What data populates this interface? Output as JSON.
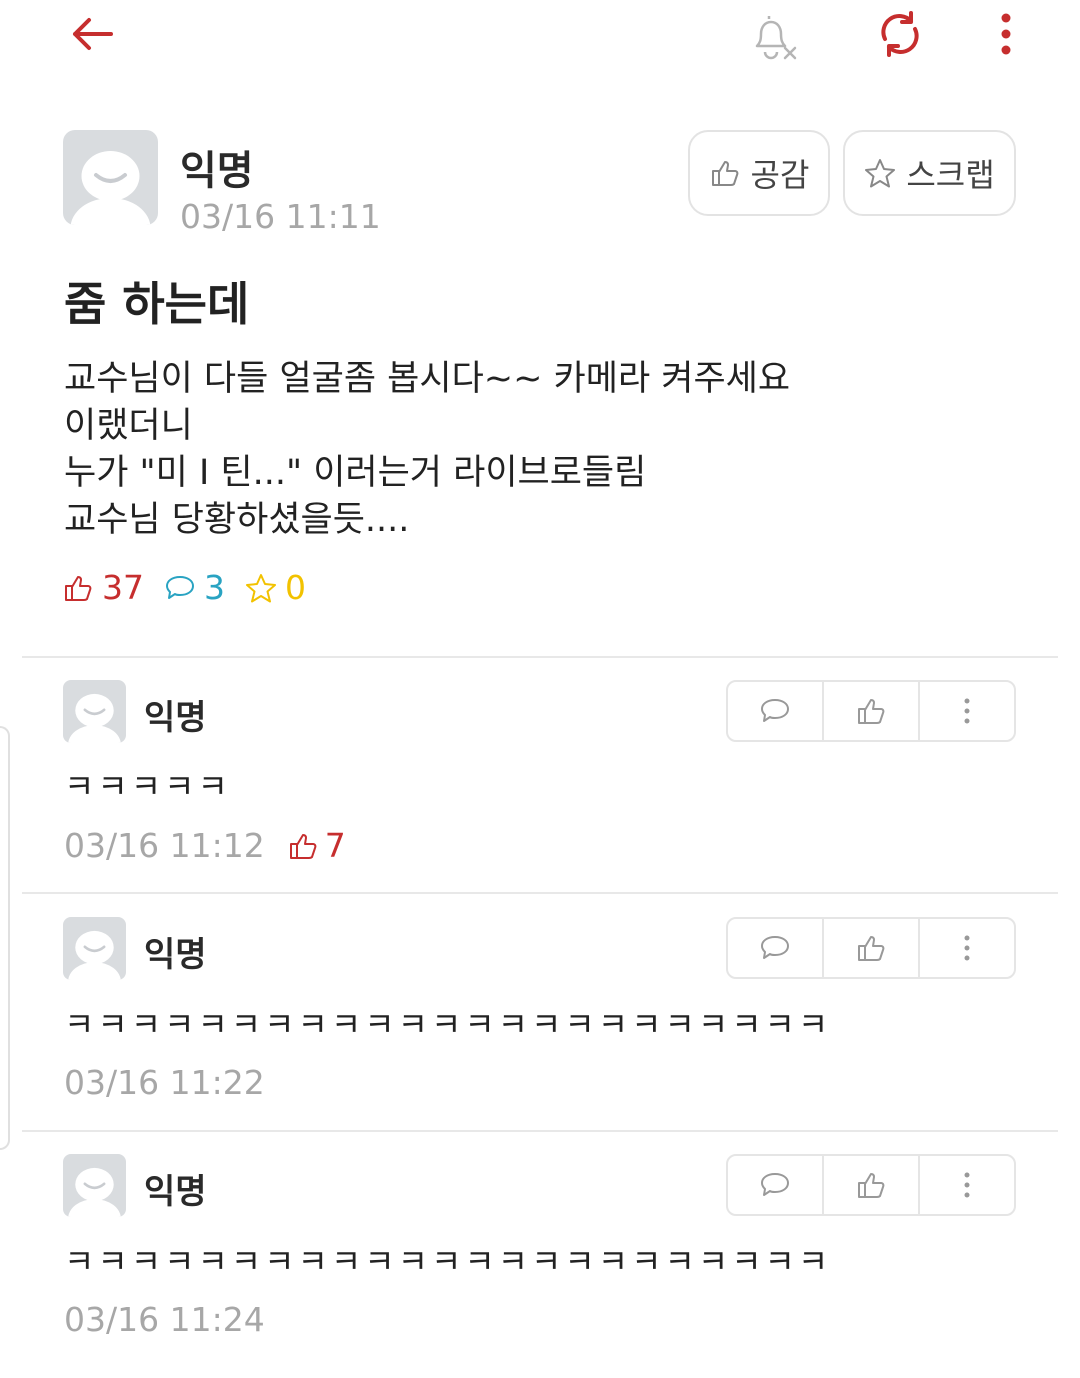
{
  "colors": {
    "accent": "#c62e2e",
    "comment_blue": "#29a3c2",
    "scrap_yellow": "#f2c200",
    "muted": "#a7a7a7"
  },
  "topbar": {
    "back_icon": "arrow-left-icon",
    "notify_icon": "bell-off-icon",
    "refresh_icon": "refresh-icon",
    "menu_icon": "more-vertical-icon"
  },
  "post": {
    "author": "익명",
    "timestamp": "03/16 11:11",
    "like_button_label": "공감",
    "scrap_button_label": "스크랩",
    "title": "줌 하는데",
    "body_lines": [
      "교수님이 다들 얼굴좀 봅시다~~ 카메라 켜주세요",
      "이랬더니",
      "누가 \"미 I 틴...\" 이러는거 라이브로들림",
      "교수님 당황하셨을듯...."
    ],
    "stats": {
      "likes": "37",
      "comments": "3",
      "scraps": "0"
    }
  },
  "comments": [
    {
      "author": "익명",
      "text": "ㅋㅋㅋㅋㅋ",
      "timestamp": "03/16 11:12",
      "likes": "7"
    },
    {
      "author": "익명",
      "text": "ㅋㅋㅋㅋㅋㅋㅋㅋㅋㅋㅋㅋㅋㅋㅋㅋㅋㅋㅋㅋㅋㅋㅋ",
      "timestamp": "03/16 11:22",
      "likes": null
    },
    {
      "author": "익명",
      "text": "ㅋㅋㅋㅋㅋㅋㅋㅋㅋㅋㅋㅋㅋㅋㅋㅋㅋㅋㅋㅋㅋㅋㅋ",
      "timestamp": "03/16 11:24",
      "likes": null
    }
  ]
}
